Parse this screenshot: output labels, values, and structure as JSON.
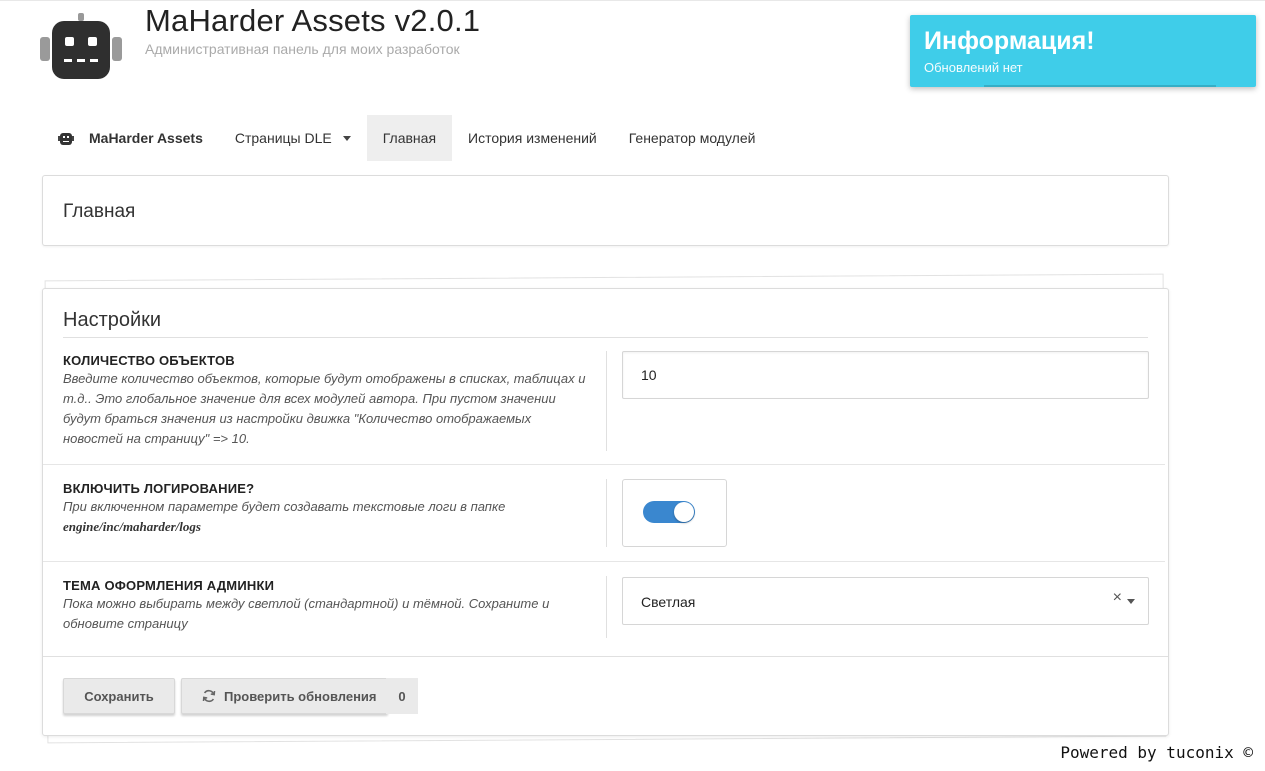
{
  "header": {
    "title": "MaHarder Assets v2.0.1",
    "subtitle": "Административная панель для моих разработок",
    "logo_icon": "robot-icon"
  },
  "notification": {
    "title": "Информация!",
    "text": "Обновлений нет",
    "color": "#3fcde9"
  },
  "nav": {
    "brand": "MaHarder Assets",
    "items": [
      {
        "label": "Страницы DLE",
        "dropdown": true,
        "active": false
      },
      {
        "label": "Главная",
        "active": true
      },
      {
        "label": "История изменений",
        "active": false
      },
      {
        "label": "Генератор модулей",
        "active": false
      }
    ]
  },
  "page": {
    "heading": "Главная"
  },
  "settings": {
    "title": "Настройки",
    "rows": [
      {
        "label": "КОЛИЧЕСТВО ОБЪЕКТОВ",
        "description": "Введите количество объектов, которые будут отображены в списках, таблицах и т.д.. Это глобальное значение для всех модулей автора. При пустом значении будут браться значения из настройки движка \"Количество отображаемых новостей на страницу\" => 10.",
        "value": "10"
      },
      {
        "label": "ВКЛЮЧИТЬ ЛОГИРОВАНИЕ?",
        "description": "При включенном параметре будет создавать текстовые логи в папке",
        "path": "engine/inc/maharder/logs",
        "enabled": true
      },
      {
        "label": "ТЕМА ОФОРМЛЕНИЯ АДМИНКИ",
        "description": "Пока можно выбирать между светлой (стандартной) и тёмной. Сохраните и обновите страницу",
        "selected": "Светлая",
        "clear_symbol": "×"
      }
    ],
    "buttons": {
      "save": "Сохранить",
      "check_updates": "Проверить обновления",
      "updates_count": "0"
    }
  },
  "footer": {
    "powered": "Powered by tuconix ©"
  },
  "colors": {
    "accent": "#3a87cf",
    "active_nav": "#eeeeee"
  }
}
